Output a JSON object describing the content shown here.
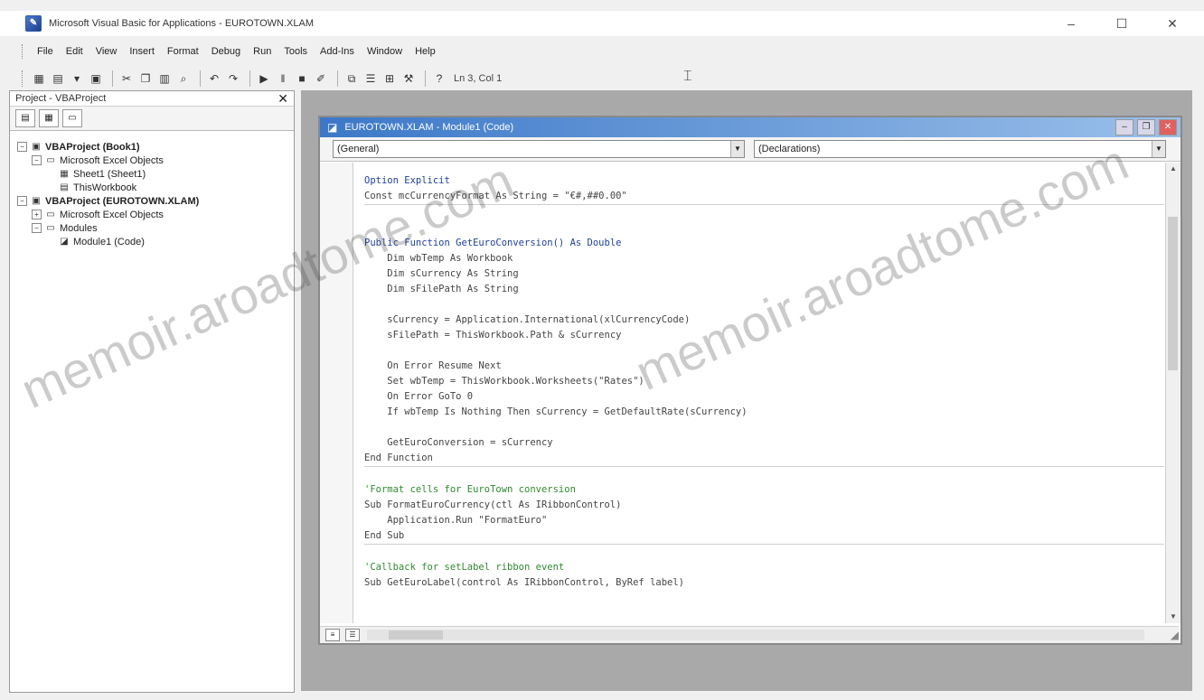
{
  "window": {
    "title": "Microsoft Visual Basic for Applications - EUROTOWN.XLAM",
    "controls": [
      "–",
      "☐",
      "✕"
    ]
  },
  "menu": {
    "items": [
      "File",
      "Edit",
      "View",
      "Insert",
      "Format",
      "Debug",
      "Run",
      "Tools",
      "Add-Ins",
      "Window",
      "Help"
    ]
  },
  "toolbar": {
    "position_label": "Ln 3, Col 1"
  },
  "project_explorer": {
    "title": "Project - VBAProject",
    "close_glyph": "✕",
    "tree": [
      {
        "label": "VBAProject (Book1)",
        "bold": true,
        "expander": "−",
        "icon": "▣"
      },
      {
        "label": "Microsoft Excel Objects",
        "bold": false,
        "expander": "−",
        "icon": "▭"
      },
      {
        "label": "Sheet1 (Sheet1)",
        "bold": false,
        "expander": "",
        "icon": "▦"
      },
      {
        "label": "ThisWorkbook",
        "bold": false,
        "expander": "",
        "icon": "▤"
      },
      {
        "label": "VBAProject (EUROTOWN.XLAM)",
        "bold": true,
        "expander": "−",
        "icon": "▣"
      },
      {
        "label": "Microsoft Excel Objects",
        "bold": false,
        "expander": "+",
        "icon": "▭"
      },
      {
        "label": "Modules",
        "bold": false,
        "expander": "−",
        "icon": "▭"
      },
      {
        "label": "Module1 (Code)",
        "bold": false,
        "expander": "",
        "icon": "◪"
      }
    ]
  },
  "code_window": {
    "title": "EUROTOWN.XLAM - Module1 (Code)",
    "object_dropdown": "(General)",
    "procedure_dropdown": "(Declarations)",
    "lines": [
      {
        "text": "Option Explicit",
        "style": "kw"
      },
      {
        "text": "Const mcCurrencyFormat As String = \"€#,##0.00\"",
        "style": "sep"
      },
      {
        "text": "",
        "style": ""
      },
      {
        "text": "",
        "style": ""
      },
      {
        "text": "Public Function GetEuroConversion() As Double",
        "style": "kw"
      },
      {
        "text": "    Dim wbTemp As Workbook",
        "style": ""
      },
      {
        "text": "    Dim sCurrency As String",
        "style": ""
      },
      {
        "text": "    Dim sFilePath As String",
        "style": ""
      },
      {
        "text": "",
        "style": ""
      },
      {
        "text": "    sCurrency = Application.International(xlCurrencyCode)",
        "style": ""
      },
      {
        "text": "    sFilePath = ThisWorkbook.Path & sCurrency",
        "style": ""
      },
      {
        "text": "",
        "style": ""
      },
      {
        "text": "    On Error Resume Next",
        "style": ""
      },
      {
        "text": "    Set wbTemp = ThisWorkbook.Worksheets(\"Rates\")",
        "style": ""
      },
      {
        "text": "    On Error GoTo 0",
        "style": ""
      },
      {
        "text": "    If wbTemp Is Nothing Then sCurrency = GetDefaultRate(sCurrency)",
        "style": ""
      },
      {
        "text": "",
        "style": ""
      },
      {
        "text": "    GetEuroConversion = sCurrency",
        "style": ""
      },
      {
        "text": "End Function",
        "style": "sep"
      },
      {
        "text": "",
        "style": ""
      },
      {
        "text": "'Format cells for EuroTown conversion",
        "style": "comment"
      },
      {
        "text": "Sub FormatEuroCurrency(ctl As IRibbonControl)",
        "style": ""
      },
      {
        "text": "    Application.Run \"FormatEuro\"",
        "style": ""
      },
      {
        "text": "End Sub",
        "style": "sep"
      },
      {
        "text": "",
        "style": ""
      },
      {
        "text": "'Callback for setLabel ribbon event",
        "style": "comment"
      },
      {
        "text": "Sub GetEuroLabel(control As IRibbonControl, ByRef label)",
        "style": ""
      }
    ]
  },
  "watermark": {
    "text": "memoir.aroadtome.com"
  }
}
